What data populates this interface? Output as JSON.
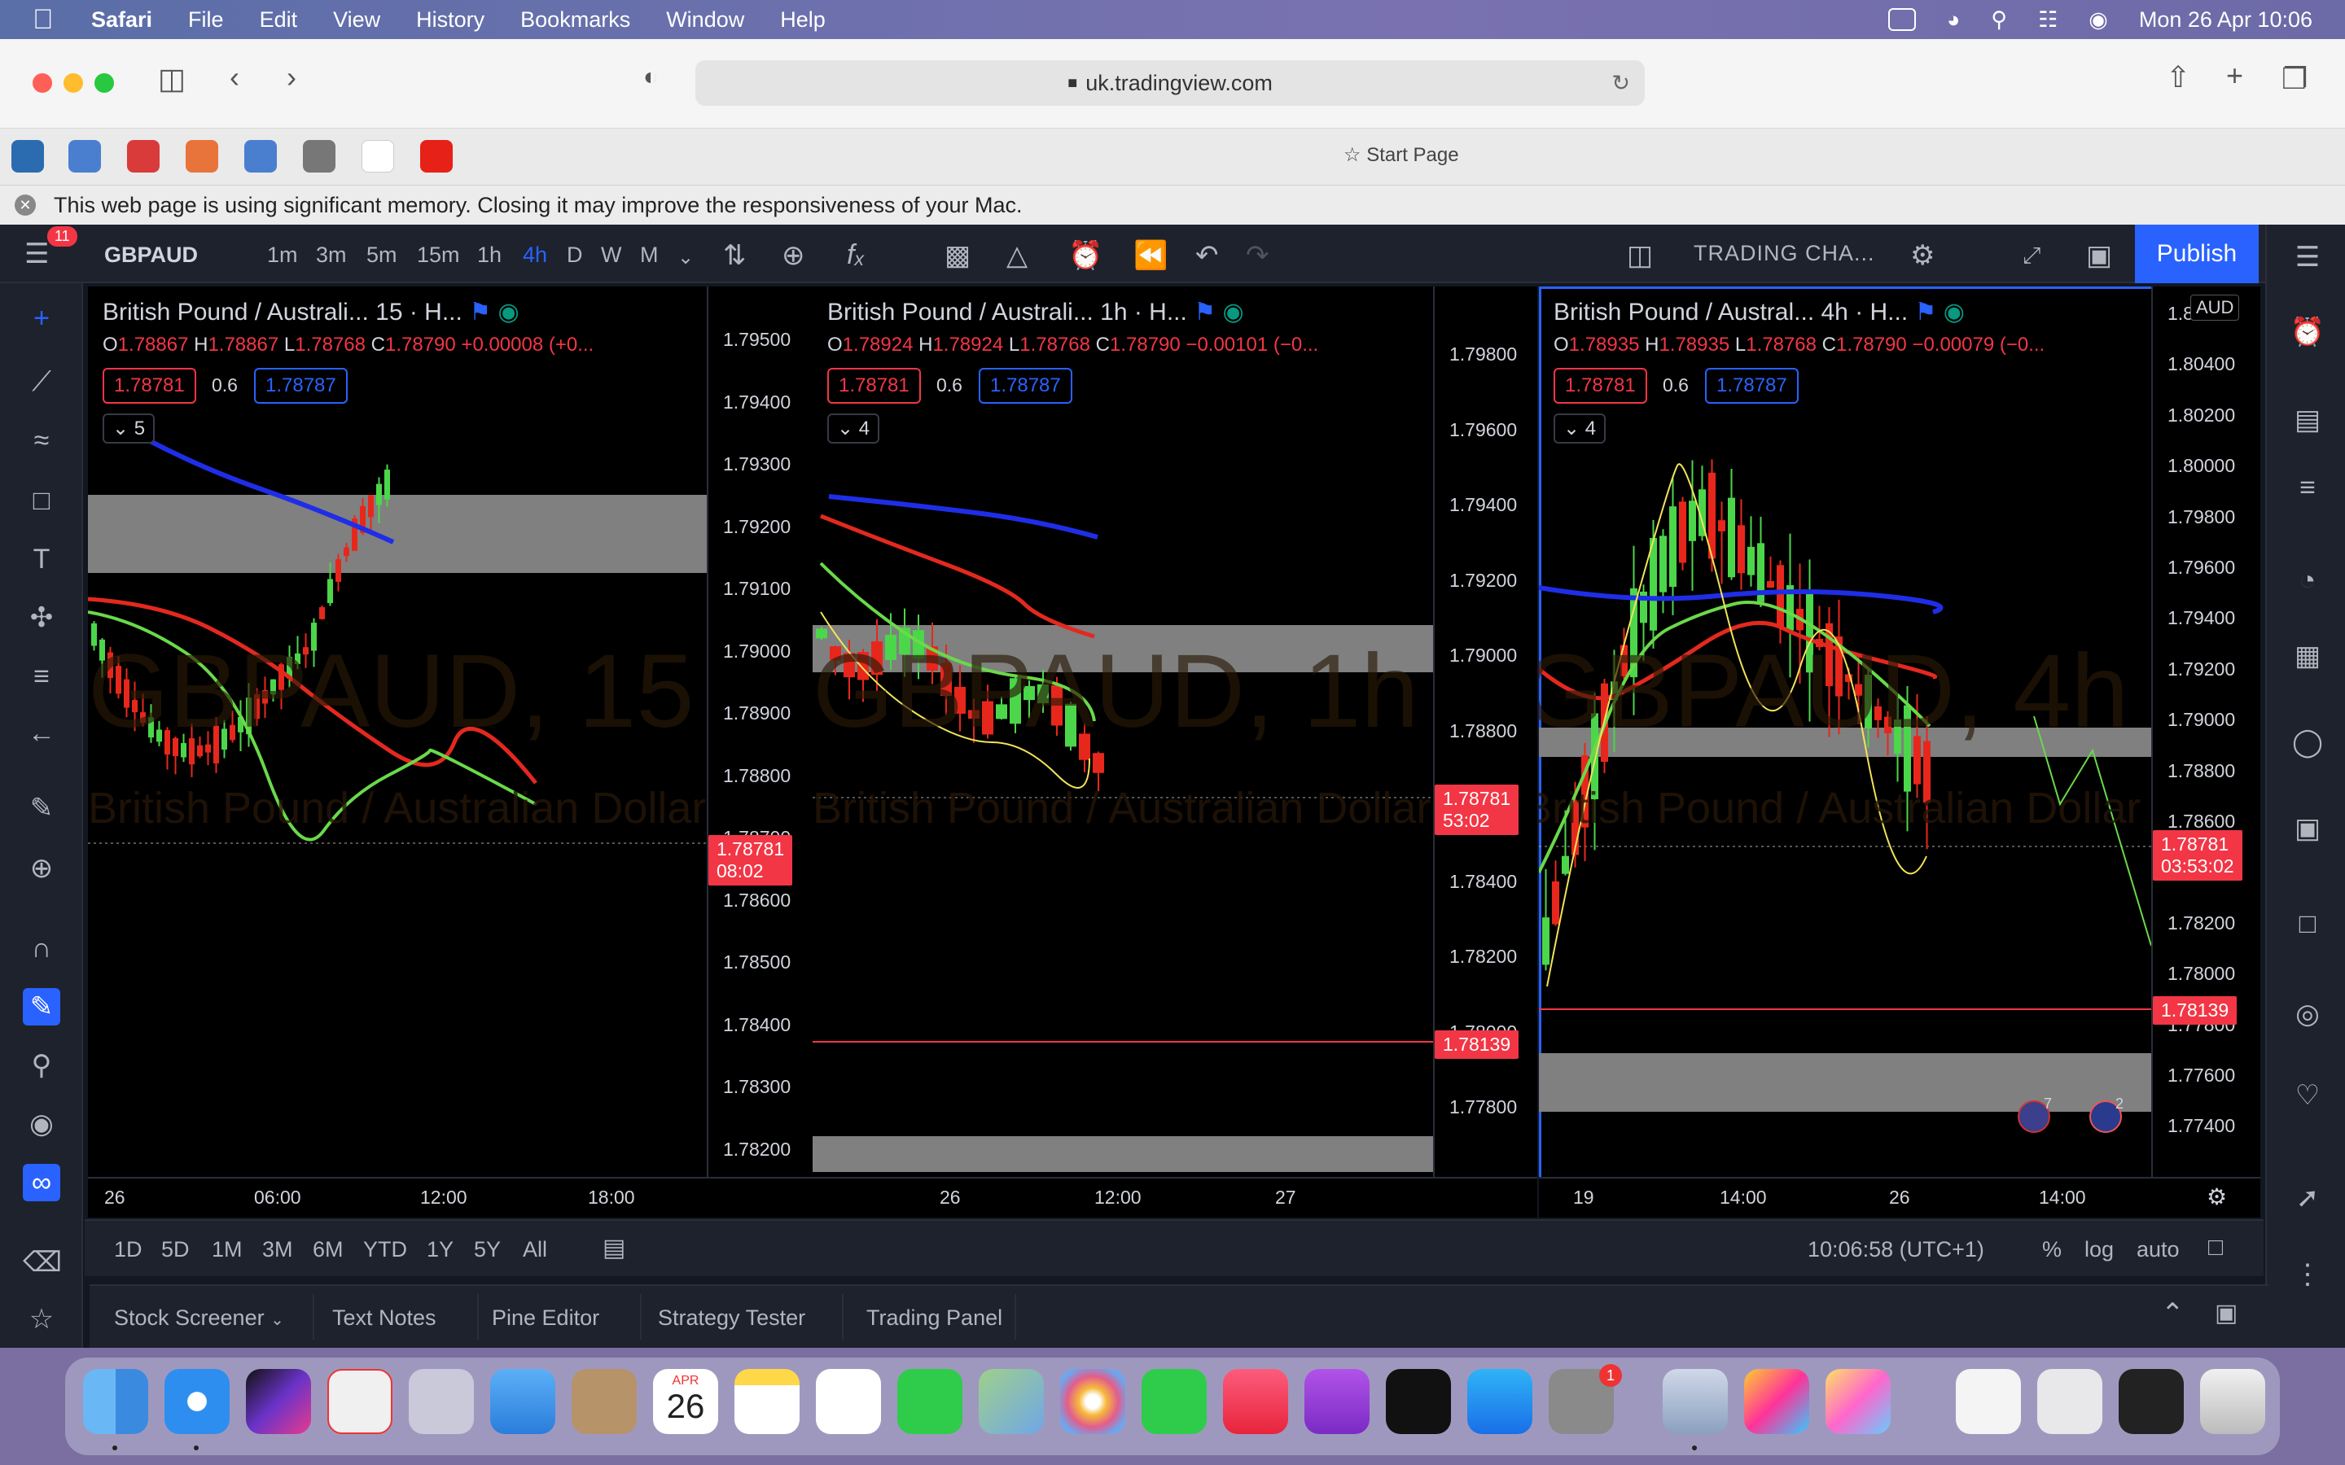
{
  "menubar": {
    "app": "Safari",
    "items": [
      "File",
      "Edit",
      "View",
      "History",
      "Bookmarks",
      "Window",
      "Help"
    ],
    "clock": "Mon 26 Apr  10:06"
  },
  "browser": {
    "url": "uk.tradingview.com",
    "start_page": "Start Page",
    "memory_warning": "This web page is using significant memory. Closing it may improve the responsiveness of your Mac."
  },
  "tv": {
    "symbol": "GBPAUD",
    "timeframes": [
      "1m",
      "3m",
      "5m",
      "15m",
      "1h",
      "4h",
      "D",
      "W",
      "M"
    ],
    "active_timeframe": "4h",
    "layout_label": "TRADING CHA...",
    "publish": "Publish",
    "notification_count": "11",
    "ranges": [
      "1D",
      "5D",
      "1M",
      "3M",
      "6M",
      "YTD",
      "1Y",
      "5Y",
      "All"
    ],
    "timezone": "10:06:58 (UTC+1)",
    "scale_options": [
      "%",
      "log",
      "auto"
    ],
    "panels": [
      "Stock Screener",
      "Text Notes",
      "Pine Editor",
      "Strategy Tester",
      "Trading Panel"
    ]
  },
  "panes": [
    {
      "title": "British Pound / Australi...  15 · H...",
      "o": "1.78867",
      "h": "1.78867",
      "l": "1.78768",
      "c": "1.78790",
      "chg": "+0.00008 (+0...",
      "sell": "1.78781",
      "spread": "0.6",
      "buy": "1.78787",
      "indicators": "5",
      "watermark": "GBPAUD, 15",
      "watermark_sub": "British Pound / Australian Dollar",
      "yticks": [
        "1.79500",
        "1.79400",
        "1.79300",
        "1.79200",
        "1.79100",
        "1.79000",
        "1.78900",
        "1.78800",
        "1.78700",
        "1.78600",
        "1.78500",
        "1.78400",
        "1.78300",
        "1.78200"
      ],
      "price": "1.78781",
      "countdown": "08:02",
      "xticks": [
        "26",
        "06:00",
        "12:00",
        "18:00"
      ]
    },
    {
      "title": "British Pound / Australi...  1h · H...",
      "o": "1.78924",
      "h": "1.78924",
      "l": "1.78768",
      "c": "1.78790",
      "chg": "−0.00101 (−0...",
      "sell": "1.78781",
      "spread": "0.6",
      "buy": "1.78787",
      "indicators": "4",
      "watermark": "GBPAUD, 1h",
      "watermark_sub": "British Pound / Australian Dollar",
      "yticks": [
        "1.79800",
        "1.79600",
        "1.79400",
        "1.79200",
        "1.79000",
        "1.78800",
        "1.78600",
        "1.78400",
        "1.78200",
        "1.78000",
        "1.77800"
      ],
      "price": "1.78781",
      "countdown": "53:02",
      "line_price": "1.78139",
      "xticks": [
        "26",
        "12:00",
        "27"
      ]
    },
    {
      "title": "British Pound / Austral...  4h · H...",
      "o": "1.78935",
      "h": "1.78935",
      "l": "1.78768",
      "c": "1.78790",
      "chg": "−0.00079 (−0...",
      "sell": "1.78781",
      "spread": "0.6",
      "buy": "1.78787",
      "indicators": "4",
      "watermark": "GBPAUD, 4h",
      "watermark_sub": "British Pound / Australian Dollar",
      "currency": "AUD",
      "yticks": [
        "1.80600",
        "1.80400",
        "1.80200",
        "1.80000",
        "1.79800",
        "1.79600",
        "1.79400",
        "1.79200",
        "1.79000",
        "1.78800",
        "1.78600",
        "1.78400",
        "1.78200",
        "1.78000",
        "1.77800",
        "1.77600",
        "1.77400"
      ],
      "price": "1.78781",
      "countdown": "03:53:02",
      "line_price": "1.78139",
      "xticks": [
        "19",
        "14:00",
        "26",
        "14:00"
      ],
      "events": [
        "7",
        "2"
      ]
    }
  ],
  "dock": {
    "calendar_month": "APR",
    "calendar_day": "26",
    "settings_badge": "1"
  }
}
